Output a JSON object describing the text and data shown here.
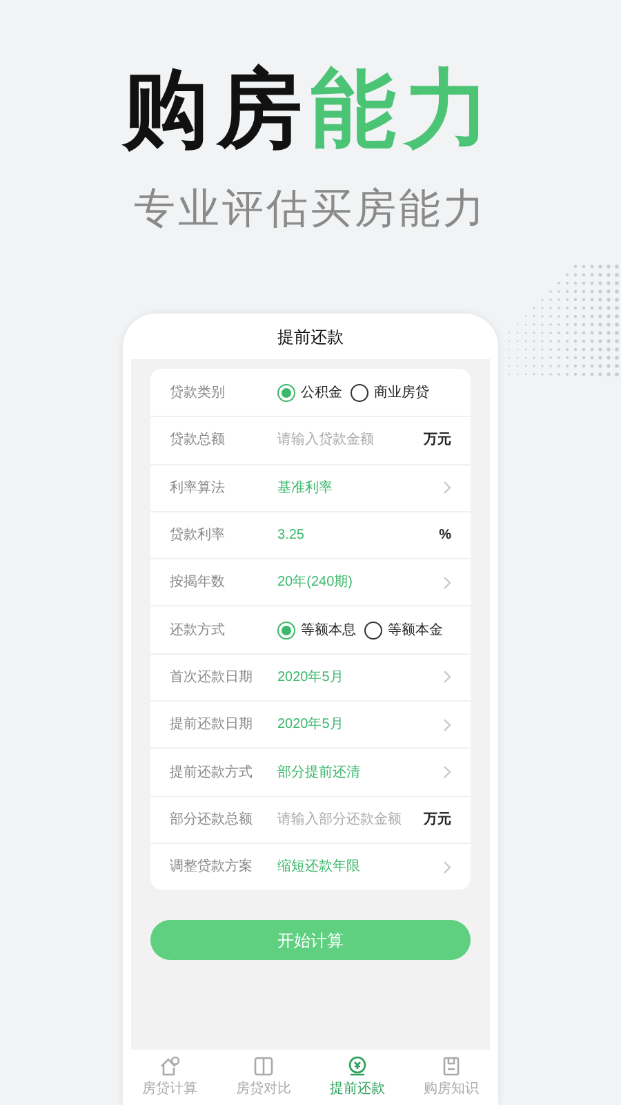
{
  "headline": {
    "dark": "购房",
    "accent": "能力"
  },
  "subtitle": "专业评估买房能力",
  "screen_title": "提前还款",
  "rows": [
    {
      "kind": "radio",
      "label": "贷款类别",
      "options": [
        {
          "label": "公积金",
          "selected": true
        },
        {
          "label": "商业房贷",
          "selected": false
        }
      ]
    },
    {
      "kind": "input",
      "label": "贷款总额",
      "placeholder": "请输入贷款金额",
      "unit": "万元"
    },
    {
      "kind": "select",
      "label": "利率算法",
      "value": "基准利率"
    },
    {
      "kind": "value",
      "label": "贷款利率",
      "value": "3.25",
      "unit": "%"
    },
    {
      "kind": "select",
      "label": "按揭年数",
      "value": "20年(240期)"
    },
    {
      "kind": "radio",
      "label": "还款方式",
      "options": [
        {
          "label": "等额本息",
          "selected": true
        },
        {
          "label": "等额本金",
          "selected": false
        }
      ]
    },
    {
      "kind": "select",
      "label": "首次还款日期",
      "value": "2020年5月"
    },
    {
      "kind": "select",
      "label": "提前还款日期",
      "value": "2020年5月"
    },
    {
      "kind": "select",
      "label": "提前还款方式",
      "value": "部分提前还清"
    },
    {
      "kind": "input",
      "label": "部分还款总额",
      "placeholder": "请输入部分还款金额",
      "unit": "万元"
    },
    {
      "kind": "select",
      "label": "调整贷款方案",
      "value": "缩短还款年限"
    }
  ],
  "button": "开始计算",
  "tabs": [
    {
      "label": "房贷计算",
      "kind": "house",
      "selected": false
    },
    {
      "label": "房贷对比",
      "kind": "compare",
      "selected": false
    },
    {
      "label": "提前还款",
      "kind": "coin",
      "selected": true
    },
    {
      "label": "购房知识",
      "kind": "book",
      "selected": false
    }
  ]
}
